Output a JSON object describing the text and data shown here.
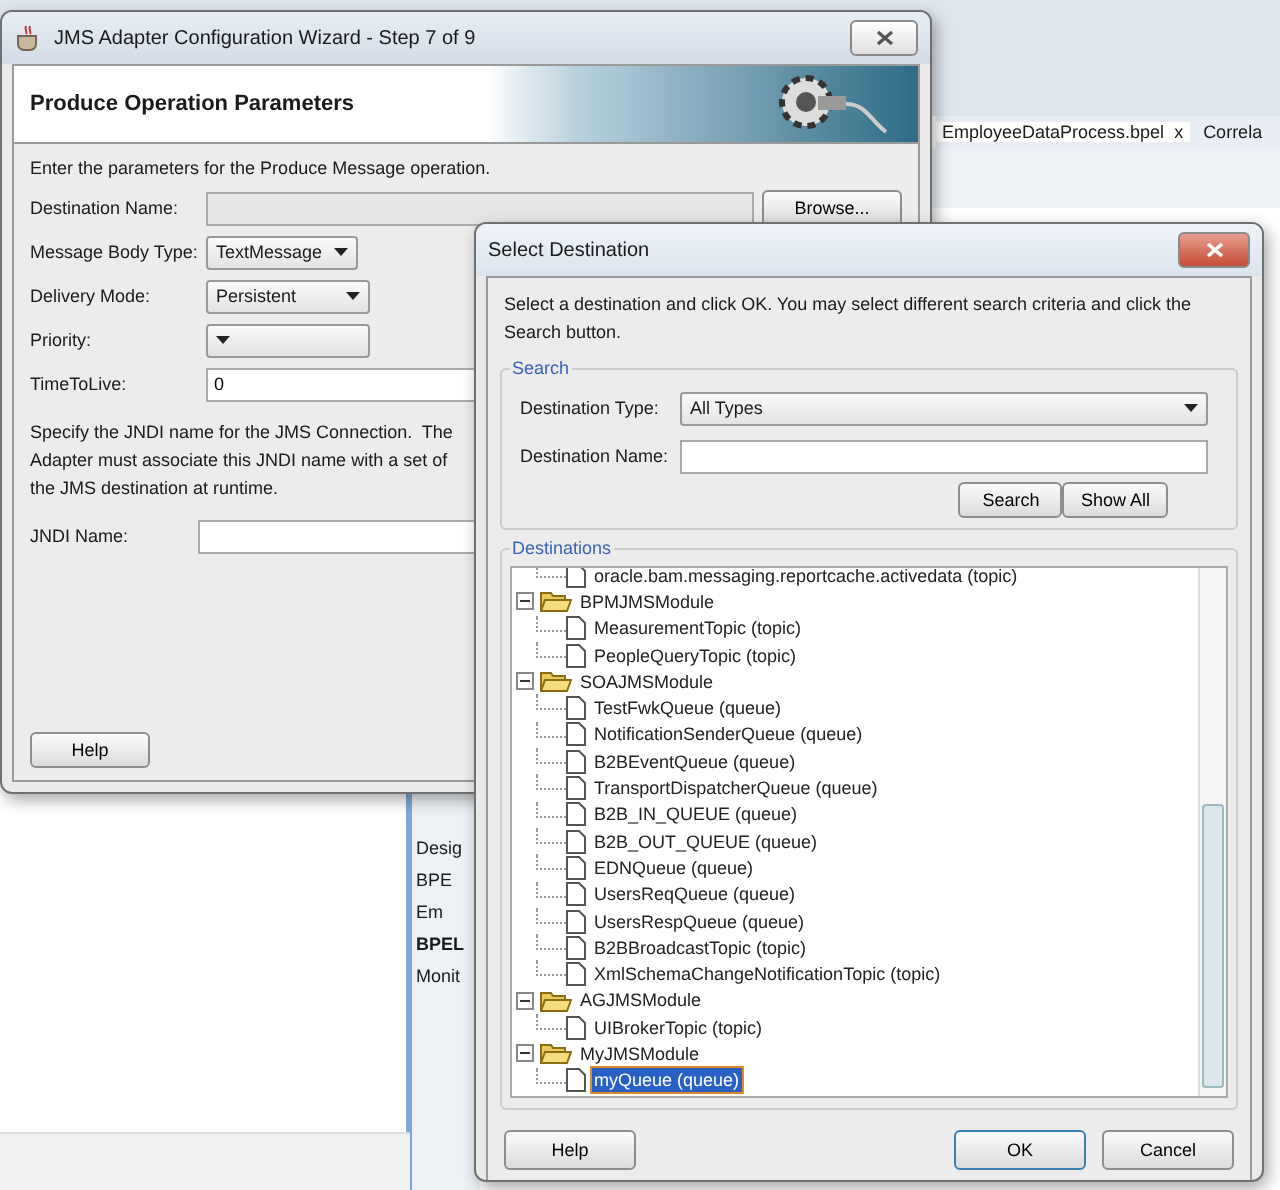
{
  "ide": {
    "tabs": [
      {
        "label": "EmployeeDataProcess.bpel",
        "close": "x",
        "selected": true
      },
      {
        "label": "Correla",
        "selected": false
      }
    ],
    "side_items": [
      "Desig",
      "BPE",
      "Em",
      "BPEL",
      "Monit"
    ]
  },
  "wizard": {
    "title": "JMS Adapter Configuration Wizard - Step 7 of 9",
    "heading": "Produce Operation Parameters",
    "instruction": "Enter the parameters for the Produce Message operation.",
    "fields": [
      {
        "kind": "text",
        "label": "Destination Name:",
        "disabled": true,
        "button": "Browse..."
      },
      {
        "kind": "select",
        "label": "Message Body Type:",
        "value": "TextMessage"
      },
      {
        "kind": "select",
        "label": "Delivery Mode:",
        "value": "Persistent"
      },
      {
        "kind": "select",
        "label": "Priority:"
      },
      {
        "kind": "text",
        "label": "TimeToLive:",
        "value": "0",
        "disabled": false
      }
    ],
    "jndi_note": [
      "Specify the JNDI name for the JMS Connection.  The",
      "Adapter must associate this JNDI name with a set of",
      "the JMS destination at runtime."
    ],
    "jndi_label": "JNDI Name:",
    "help_button": "Help"
  },
  "dialog": {
    "title": "Select Destination",
    "instruction": "Select a destination and click OK. You may select different search criteria and click the Search button.",
    "search": {
      "legend": "Search",
      "type_label": "Destination Type:",
      "type_value": "All Types",
      "name_label": "Destination Name:",
      "buttons": [
        "Search",
        "Show All"
      ]
    },
    "destinations": {
      "legend": "Destinations",
      "tree": [
        {
          "label": "oracle.bam.messaging.reportcache.activedata (topic)",
          "selected": false
        },
        {
          "label": "BPMJMSModule",
          "expanded": true,
          "children": [
            {
              "label": "MeasurementTopic (topic)",
              "selected": false
            },
            {
              "label": "PeopleQueryTopic (topic)",
              "selected": false
            }
          ]
        },
        {
          "label": "SOAJMSModule",
          "expanded": true,
          "children": [
            {
              "label": "TestFwkQueue (queue)",
              "selected": false
            },
            {
              "label": "NotificationSenderQueue (queue)",
              "selected": false
            },
            {
              "label": "B2BEventQueue (queue)",
              "selected": false
            },
            {
              "label": "TransportDispatcherQueue (queue)",
              "selected": false
            },
            {
              "label": "B2B_IN_QUEUE (queue)",
              "selected": false
            },
            {
              "label": "B2B_OUT_QUEUE (queue)",
              "selected": false
            },
            {
              "label": "EDNQueue (queue)",
              "selected": false
            },
            {
              "label": "UsersReqQueue (queue)",
              "selected": false
            },
            {
              "label": "UsersRespQueue (queue)",
              "selected": false
            },
            {
              "label": "B2BBroadcastTopic (topic)",
              "selected": false
            },
            {
              "label": "XmlSchemaChangeNotificationTopic (topic)",
              "selected": false
            }
          ]
        },
        {
          "label": "AGJMSModule",
          "expanded": true,
          "children": [
            {
              "label": "UIBrokerTopic (topic)",
              "selected": false
            }
          ]
        },
        {
          "label": "MyJMSModule",
          "expanded": true,
          "children": [
            {
              "label": "myQueue (queue)",
              "selected": true
            }
          ]
        }
      ]
    },
    "buttons": {
      "help": "Help",
      "ok": "OK",
      "cancel": "Cancel"
    }
  }
}
